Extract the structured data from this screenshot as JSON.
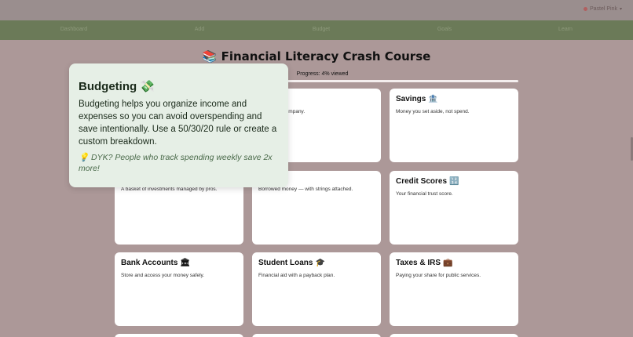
{
  "user": {
    "name": "Pastel Pink"
  },
  "nav": {
    "items": [
      "Dashboard",
      "Add",
      "Budget",
      "Goals",
      "Learn"
    ]
  },
  "course": {
    "title": "Financial Literacy Crash Course",
    "title_icon": "📚",
    "progress_label": "Progress: 4% viewed",
    "progress_percent": 4
  },
  "cards": [
    {
      "title": "",
      "icon": "",
      "desc": ""
    },
    {
      "title": "",
      "icon": "",
      "desc": "of a public company."
    },
    {
      "title": "Savings",
      "icon": "🏦",
      "desc": "Money you set aside, not spend."
    },
    {
      "title": "",
      "icon": "",
      "desc": "A basket of investments managed by pros."
    },
    {
      "title": "",
      "icon": "",
      "desc": "Borrowed money — with strings attached."
    },
    {
      "title": "Credit Scores",
      "icon": "🔢",
      "desc": "Your financial trust score."
    },
    {
      "title": "Bank Accounts",
      "icon": "🏛",
      "desc": "Store and access your money safely."
    },
    {
      "title": "Student Loans",
      "icon": "🎓",
      "desc": "Financial aid with a payback plan."
    },
    {
      "title": "Taxes & IRS",
      "icon": "💼",
      "desc": "Paying your share for public services."
    }
  ],
  "popover": {
    "title": "Budgeting",
    "title_icon": "💸",
    "body": "Budgeting helps you organize income and expenses so you can avoid overspending and save intentionally. Use a 50/30/20 rule or create a custom breakdown.",
    "tip": "💡 DYK? People who track spending weekly save 2x more!"
  }
}
